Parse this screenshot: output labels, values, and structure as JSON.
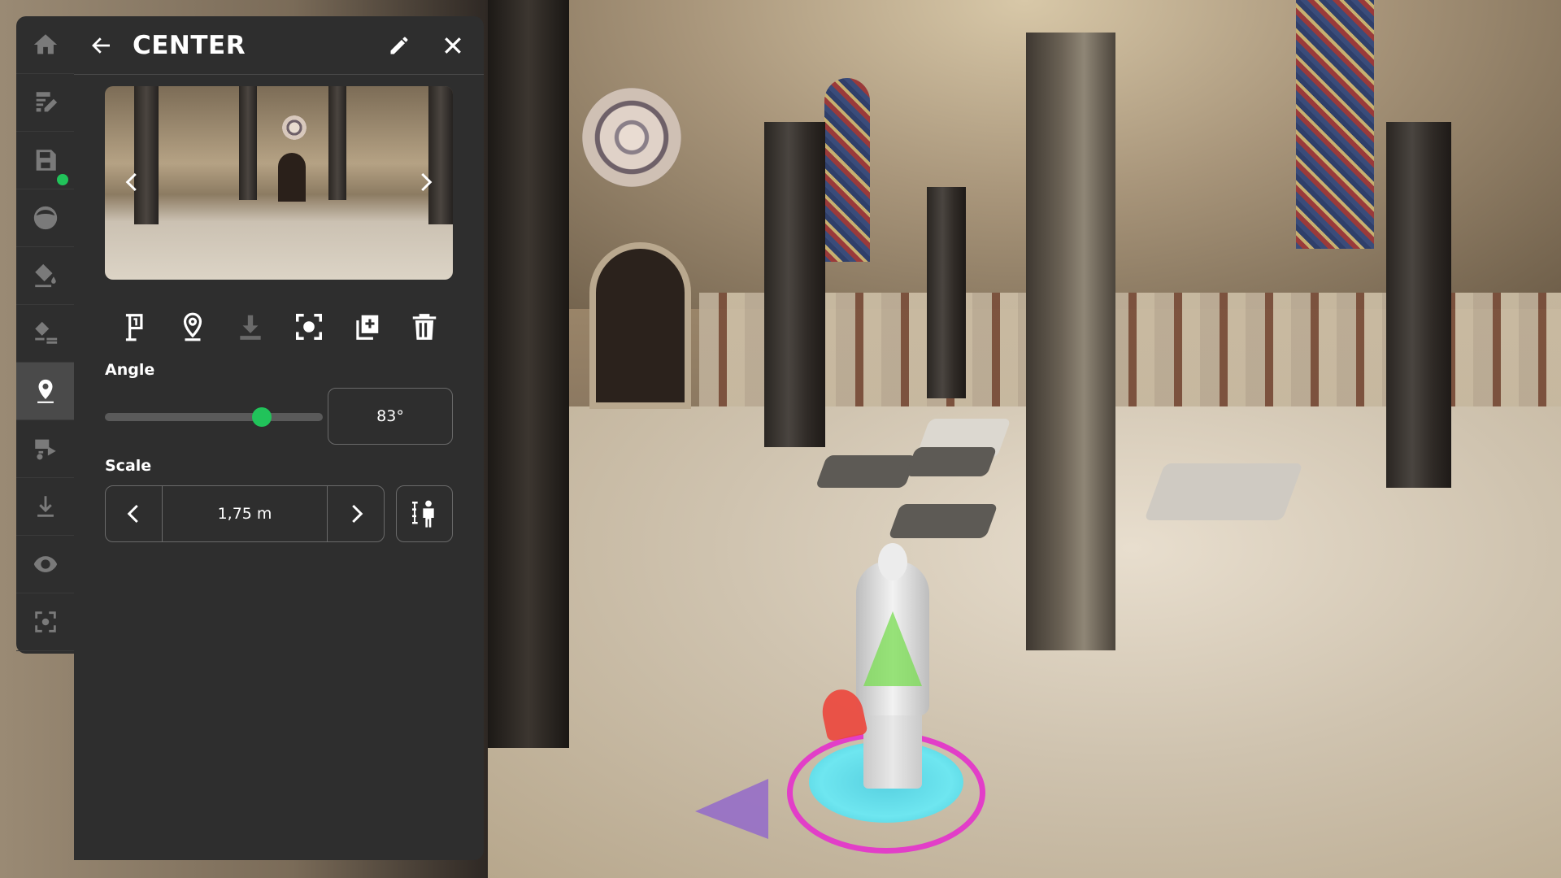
{
  "panel": {
    "title": "CENTER",
    "back_icon": "arrow-left-icon",
    "edit_icon": "pencil-icon",
    "close_icon": "close-icon"
  },
  "preview": {
    "prev_icon": "chevron-left-icon",
    "next_icon": "chevron-right-icon"
  },
  "toolbar": {
    "tools": [
      {
        "icon": "start-point-flag-icon",
        "enabled": true
      },
      {
        "icon": "map-pin-icon",
        "enabled": true
      },
      {
        "icon": "download-icon",
        "enabled": false
      },
      {
        "icon": "focus-icon",
        "enabled": true
      },
      {
        "icon": "duplicate-icon",
        "enabled": true
      },
      {
        "icon": "trash-icon",
        "enabled": true
      }
    ]
  },
  "angle": {
    "label": "Angle",
    "value_text": "83°",
    "fraction": 0.72
  },
  "scale": {
    "label": "Scale",
    "value_text": "1,75 m",
    "height_icon": "person-height-icon"
  },
  "rail": {
    "items": [
      {
        "icon": "home-icon",
        "active": false
      },
      {
        "icon": "edit-notes-icon",
        "active": false
      },
      {
        "icon": "save-icon",
        "active": false,
        "status_dot": "#21c35a"
      },
      {
        "icon": "panorama-icon",
        "active": false
      },
      {
        "icon": "paint-bucket-icon",
        "active": false
      },
      {
        "icon": "layers-paint-icon",
        "active": false
      },
      {
        "icon": "location-pin-icon",
        "active": true
      },
      {
        "icon": "media-icon",
        "active": false
      },
      {
        "icon": "download-arrow-icon",
        "active": false
      },
      {
        "icon": "visibility-icon",
        "active": false
      },
      {
        "icon": "focus-frame-icon",
        "active": false
      }
    ]
  },
  "colors": {
    "panel_bg": "#2e2e2e",
    "accent": "#21c35a",
    "text": "#ffffff",
    "muted": "#7a7a7a"
  }
}
